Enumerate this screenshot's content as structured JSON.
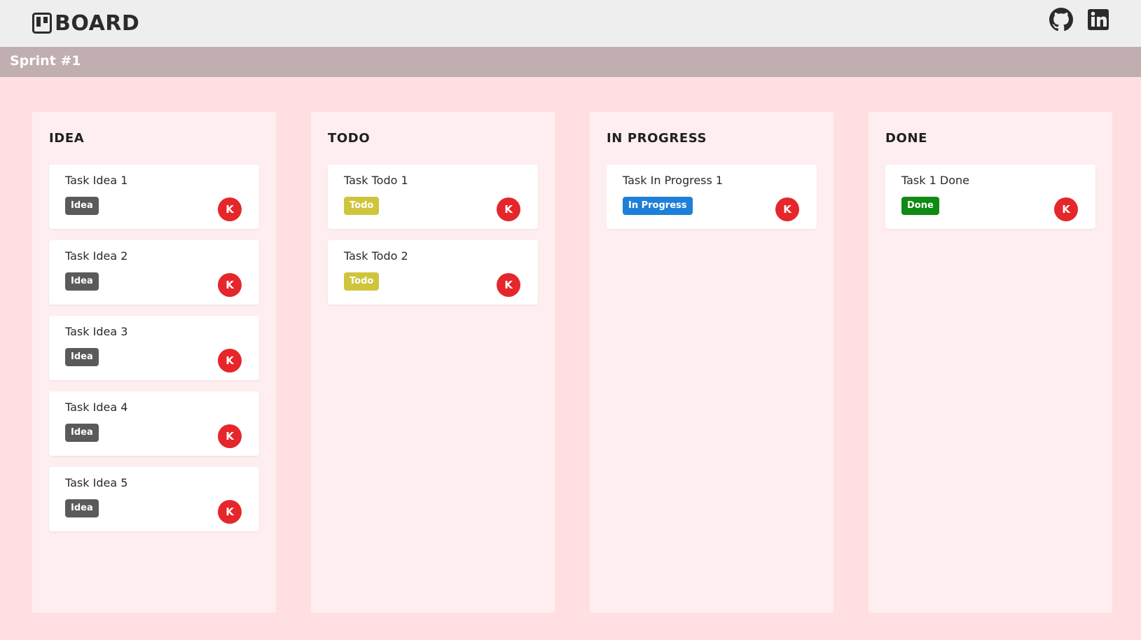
{
  "header": {
    "title": "BOARD",
    "logo_icon": "board-logo-icon",
    "links": [
      {
        "name": "github-icon"
      },
      {
        "name": "linkedin-icon"
      }
    ]
  },
  "sprint": {
    "title": "Sprint #1"
  },
  "colors": {
    "idea": "#5a5a5a",
    "todo": "#cfc53c",
    "in_progress": "#1e7fd8",
    "done": "#0f8a12",
    "avatar": "#e5262b"
  },
  "columns": [
    {
      "title": "IDEA",
      "cards": [
        {
          "title": "Task Idea 1",
          "tag": "Idea",
          "avatar": "K"
        },
        {
          "title": "Task Idea 2",
          "tag": "Idea",
          "avatar": "K"
        },
        {
          "title": "Task Idea 3",
          "tag": "Idea",
          "avatar": "K"
        },
        {
          "title": "Task Idea 4",
          "tag": "Idea",
          "avatar": "K"
        },
        {
          "title": "Task Idea 5",
          "tag": "Idea",
          "avatar": "K"
        }
      ]
    },
    {
      "title": "TODO",
      "cards": [
        {
          "title": "Task Todo 1",
          "tag": "Todo",
          "avatar": "K"
        },
        {
          "title": "Task Todo 2",
          "tag": "Todo",
          "avatar": "K"
        }
      ]
    },
    {
      "title": "IN PROGRESS",
      "cards": [
        {
          "title": "Task In Progress 1",
          "tag": "In Progress",
          "avatar": "K"
        }
      ]
    },
    {
      "title": "DONE",
      "cards": [
        {
          "title": "Task 1 Done",
          "tag": "Done",
          "avatar": "K"
        }
      ]
    }
  ]
}
